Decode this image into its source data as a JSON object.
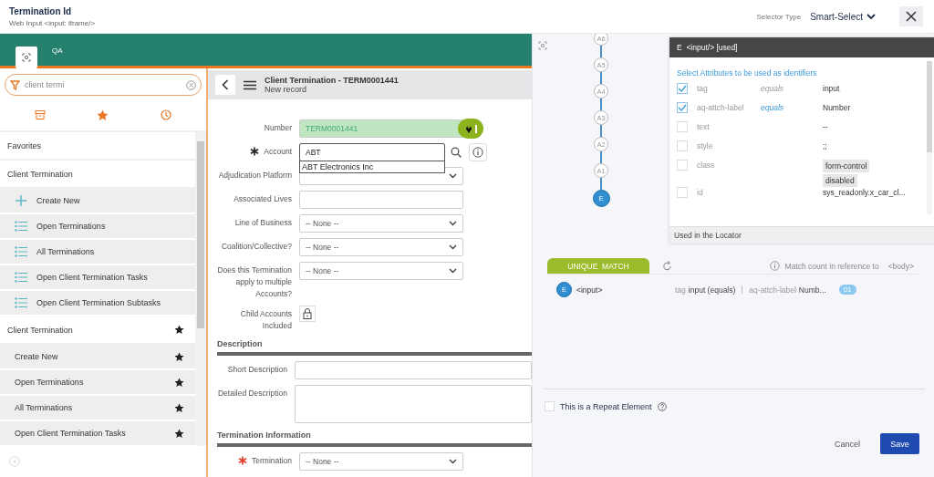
{
  "header": {
    "title": "Termination Id",
    "subtitle": "Web Input <input: iframe/>",
    "selector_type_label": "Selector Type",
    "selector_type_value": "Smart-Select"
  },
  "app": {
    "tab_label": "QA",
    "search": {
      "value": "client termi"
    },
    "sidebar": [
      {
        "kind": "section",
        "label": "Favorites",
        "starred": false
      },
      {
        "kind": "section",
        "label": "Client Termination",
        "starred": false
      },
      {
        "kind": "create",
        "label": "Create New",
        "starred": false
      },
      {
        "kind": "list",
        "label": "Open Terminations",
        "starred": false
      },
      {
        "kind": "list",
        "label": "All Terminations",
        "starred": false
      },
      {
        "kind": "list",
        "label": "Open Client Termination Tasks",
        "starred": false
      },
      {
        "kind": "list",
        "label": "Open Client Termination Subtasks",
        "starred": false
      },
      {
        "kind": "section",
        "label": "Client Termination",
        "starred": true
      },
      {
        "kind": "module",
        "label": "Create New",
        "starred": true
      },
      {
        "kind": "module",
        "label": "Open Terminations",
        "starred": true
      },
      {
        "kind": "module",
        "label": "All Terminations",
        "starred": true
      },
      {
        "kind": "module",
        "label": "Open Client Termination Tasks",
        "starred": true
      }
    ],
    "record": {
      "title": "Client Termination - TERM0001441",
      "subtitle": "New record"
    },
    "sections": [
      {
        "fields": [
          {
            "kind": "readonly",
            "label": "Number",
            "value": "TERM0001441",
            "highlighted": true
          },
          {
            "kind": "reference",
            "label": "Account",
            "required": true,
            "missing": false,
            "value": "ABT",
            "suggestion": "ABT Electronics Inc"
          },
          {
            "kind": "select",
            "label": "Adjudication Platform"
          },
          {
            "kind": "text",
            "label": "Associated Lives",
            "wide": false
          },
          {
            "kind": "select",
            "label": "Line of Business",
            "value": "-- None --"
          },
          {
            "kind": "select",
            "label": "Coalition/Collective?",
            "value": "-- None --"
          },
          {
            "kind": "select",
            "label": "Does this Termination apply to multiple Accounts?",
            "value": "-- None --"
          },
          {
            "kind": "locked",
            "label": "Child Accounts Included"
          }
        ]
      },
      {
        "heading": "Description",
        "fields": [
          {
            "kind": "text",
            "label": "Short Description",
            "wide": true
          },
          {
            "kind": "textarea",
            "label": "Detailed Description",
            "wide": true
          }
        ]
      },
      {
        "heading": "Termination Information",
        "fields": [
          {
            "kind": "select",
            "label": "Termination",
            "required": true,
            "missing": true,
            "value": "-- None --"
          }
        ]
      }
    ]
  },
  "tree": [
    {
      "label": "A6",
      "selected": false
    },
    {
      "label": "A5",
      "selected": false
    },
    {
      "label": "A4",
      "selected": false
    },
    {
      "label": "A3",
      "selected": false
    },
    {
      "label": "A2",
      "selected": false
    },
    {
      "label": "A1",
      "selected": false
    },
    {
      "label": "E",
      "selected": true
    }
  ],
  "attributes": {
    "title": "E  <input/> [used]",
    "hint": "Select Attributes to be used as identifiers",
    "rows": [
      {
        "name": "tag",
        "checked": true,
        "operator": "equals",
        "operator_active": false,
        "values": [
          "input"
        ],
        "chips": false
      },
      {
        "name": "aq-attch-label",
        "checked": true,
        "operator": "equals",
        "operator_active": true,
        "values": [
          "Number"
        ],
        "chips": false
      },
      {
        "name": "text",
        "checked": false,
        "values": [
          "--"
        ],
        "chips": false
      },
      {
        "name": "style",
        "checked": false,
        "values": [
          ";;"
        ],
        "chips": false
      },
      {
        "name": "class",
        "checked": false,
        "values": [
          "form-control",
          "disabled"
        ],
        "chips": true
      },
      {
        "name": "id",
        "checked": false,
        "values": [
          "sys_readonly.x_car_cl..."
        ],
        "chips": false
      }
    ],
    "footer": "Used in the Locator"
  },
  "match": {
    "tab": "UNIQUE  MATCH",
    "info": "Match count in reference to",
    "reference": "<body>",
    "rows": [
      {
        "node": "E",
        "element": "<input>",
        "criteria": [
          {
            "name": "tag",
            "value": "input (equals)"
          },
          {
            "name": "aq-attch-label",
            "value": "Numb..."
          }
        ],
        "count": "01"
      }
    ]
  },
  "repeat": {
    "label": "This is a Repeat Element",
    "checked": false
  },
  "buttons": [
    {
      "kind": "secondary",
      "label": "Cancel"
    },
    {
      "kind": "primary",
      "label": "Save"
    }
  ]
}
